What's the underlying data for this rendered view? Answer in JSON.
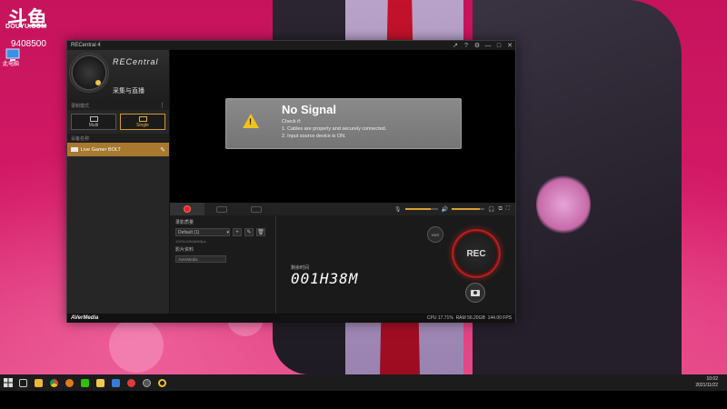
{
  "watermark": {
    "logo_text": "斗鱼",
    "url": "DOUYU.COM",
    "room_id": "9408500",
    "desktop_icon_label": "此电脑"
  },
  "window": {
    "title": "RECentral 4",
    "controls": [
      "↗",
      "?",
      "⚙",
      "—",
      "□",
      "✕"
    ],
    "brand": "RECentral",
    "subtitle": "采集与直播",
    "sections": {
      "mode": "录制模式",
      "device": "设备名称"
    },
    "modes": [
      {
        "label": "Multi",
        "active": false
      },
      {
        "label": "Single",
        "active": true
      }
    ],
    "device_name": "Live Gamer BOLT",
    "no_signal": {
      "title": "No Signal",
      "check": "Check if:",
      "line1": "1. Cables are properly and securely connected.",
      "line2": "2. Input source device is ON."
    },
    "settings": {
      "quality_label": "录影质量",
      "quality_value": "Default (1)",
      "quality_sub": "1920x1080@60fps",
      "folder_label": "影片资料",
      "folder_value": "AVerMedia"
    },
    "time_label": "剩余时间",
    "time_value": "001H38M",
    "hdr_label": "HDR",
    "rec_label": "REC",
    "status": {
      "brand": "AVerMedia",
      "cpu": "CPU 17.71%",
      "ram": "RAM 56.20GB",
      "fps": "144.00 FPS"
    }
  },
  "taskbar": {
    "time": "10:02",
    "date": "2021/11/22"
  },
  "colors": {
    "wallpaper": "#c6135c",
    "accent": "#d29a2b",
    "rec": "#e52222"
  }
}
